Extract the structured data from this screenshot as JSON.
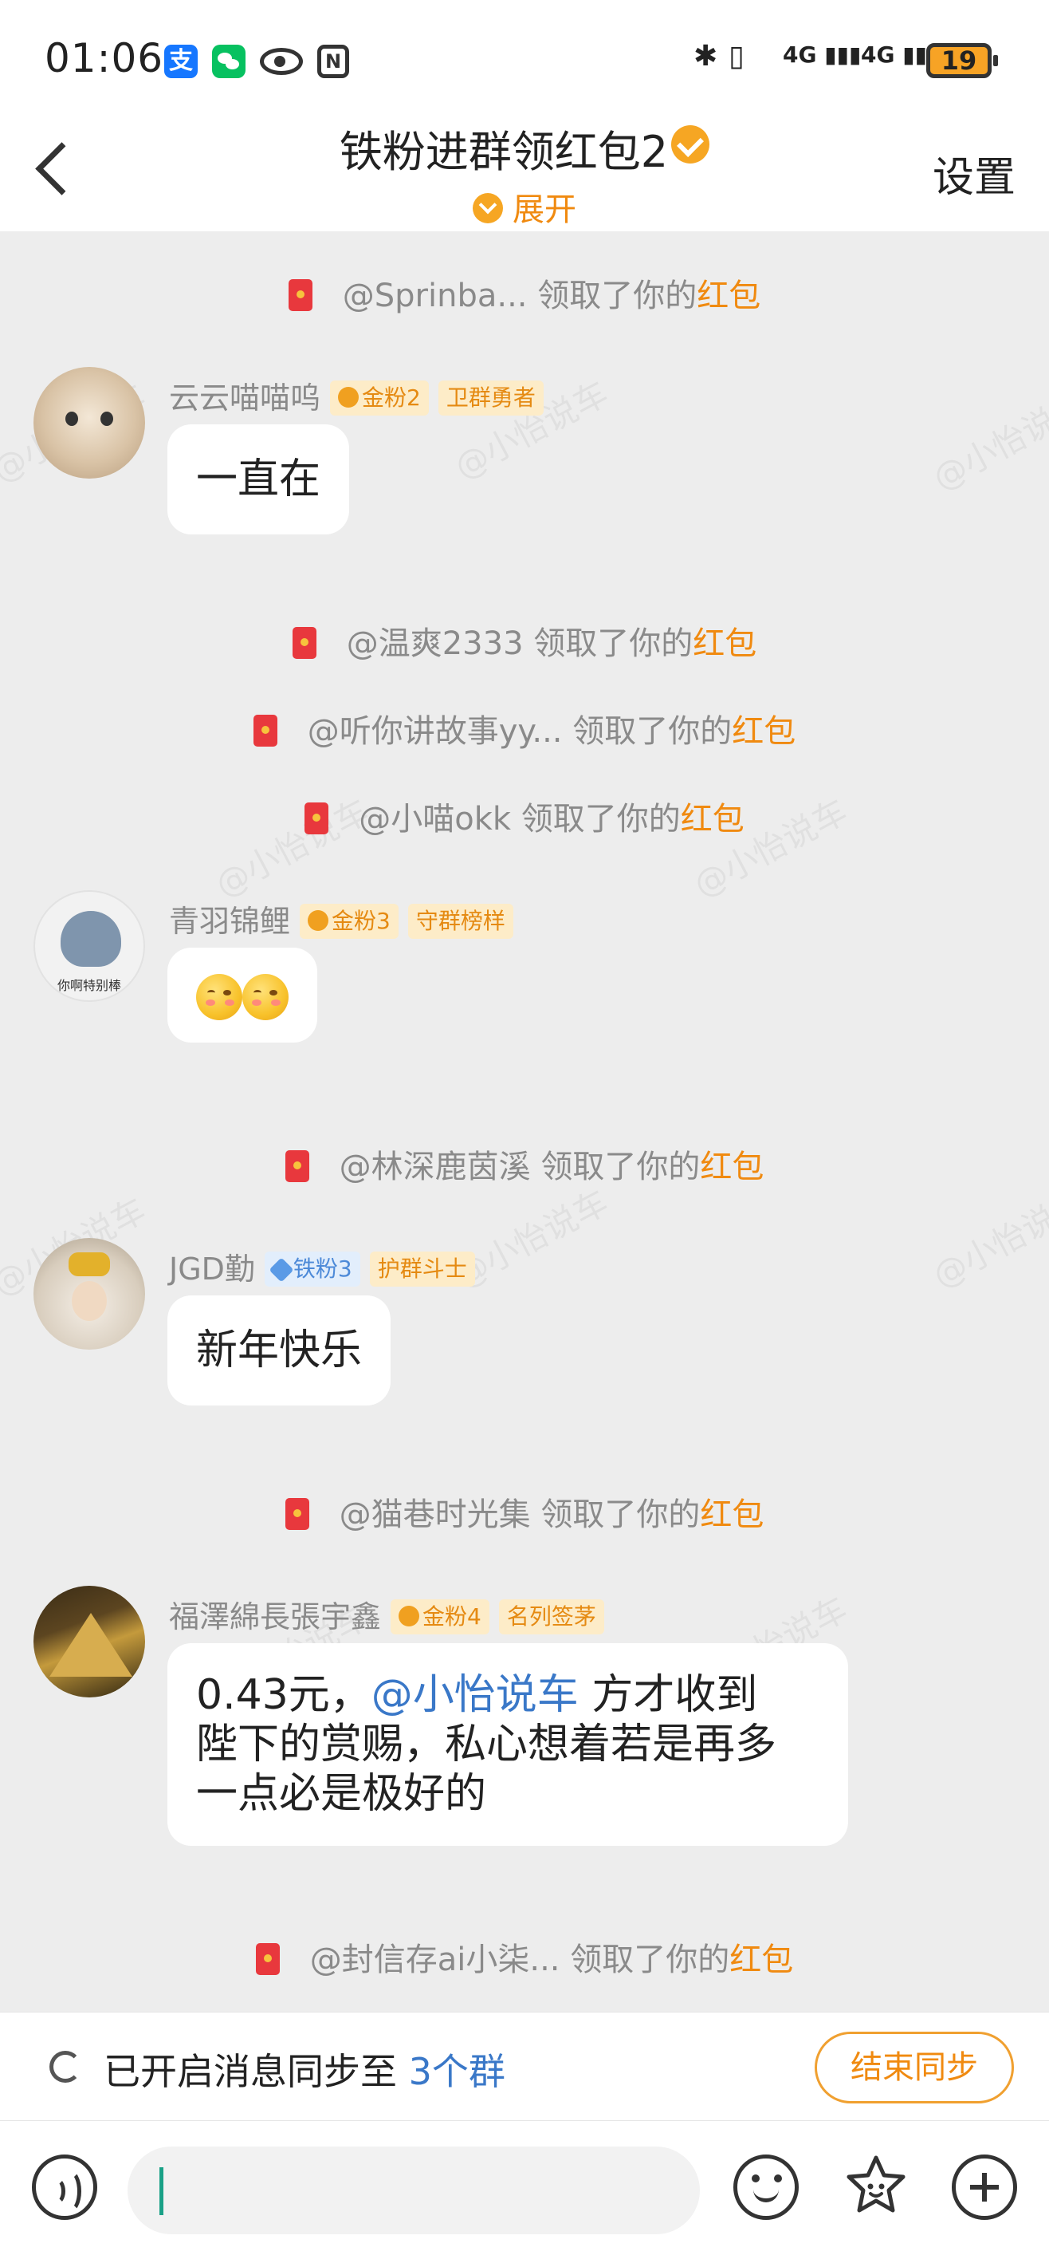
{
  "status_bar": {
    "time": "01:06",
    "alipay_label": "支",
    "nfc_label": "N",
    "bluetooth_glyph": "✱",
    "vibrate_glyph": "▯",
    "signal1_label": "4G",
    "signal2_label": "4G",
    "battery_level": "19"
  },
  "header": {
    "title": "铁粉进群领红包2",
    "expand_label": "展开",
    "settings_label": "设置"
  },
  "chat": {
    "system_messages": [
      {
        "user": "@Sprinba...",
        "action": " 领取了你的",
        "highlight": "红包"
      },
      {
        "user": "@温爽2333",
        "action": " 领取了你的",
        "highlight": "红包"
      },
      {
        "user": "@听你讲故事yy...",
        "action": " 领取了你的",
        "highlight": "红包"
      },
      {
        "user": "@小喵okk",
        "action": " 领取了你的",
        "highlight": "红包"
      },
      {
        "user": "@林深鹿茵溪",
        "action": " 领取了你的",
        "highlight": "红包"
      },
      {
        "user": "@猫巷时光集",
        "action": " 领取了你的",
        "highlight": "红包"
      },
      {
        "user": "@封信存ai小柒...",
        "action": " 领取了你的",
        "highlight": "红包"
      }
    ],
    "messages": [
      {
        "username": "云云喵喵呜",
        "fan_tag": "金粉2",
        "title_tag": "卫群勇者",
        "text": "一直在"
      },
      {
        "username": "青羽锦鲤",
        "fan_tag": "金粉3",
        "title_tag": "守群榜样",
        "avatar_text": "你啊特别棒",
        "emoji": [
          "smiling-blush-emoji",
          "smiling-blush-emoji"
        ]
      },
      {
        "username": "JGD勤",
        "fan_tag": "铁粉3",
        "title_tag": "护群斗士",
        "text": "新年快乐"
      },
      {
        "username": "福澤綿長張宇鑫",
        "fan_tag": "金粉4",
        "title_tag": "名列签茅",
        "text_prefix": "0.43元，",
        "mention": "@小怡说车",
        "text_line1_rest": " 方才收到",
        "text_line2": "陛下的赏赐，私心想着若是再多",
        "text_line3": "一点必是极好的"
      }
    ],
    "watermark": "@小怡说车"
  },
  "sync_bar": {
    "text": "已开启消息同步至 ",
    "count": "3个群",
    "end_button": "结束同步"
  },
  "input_bar": {
    "placeholder": ""
  },
  "colors": {
    "accent_orange": "#f08a10",
    "link_blue": "#3a78c8",
    "background": "#ededed",
    "red_packet": "#e8383d"
  }
}
